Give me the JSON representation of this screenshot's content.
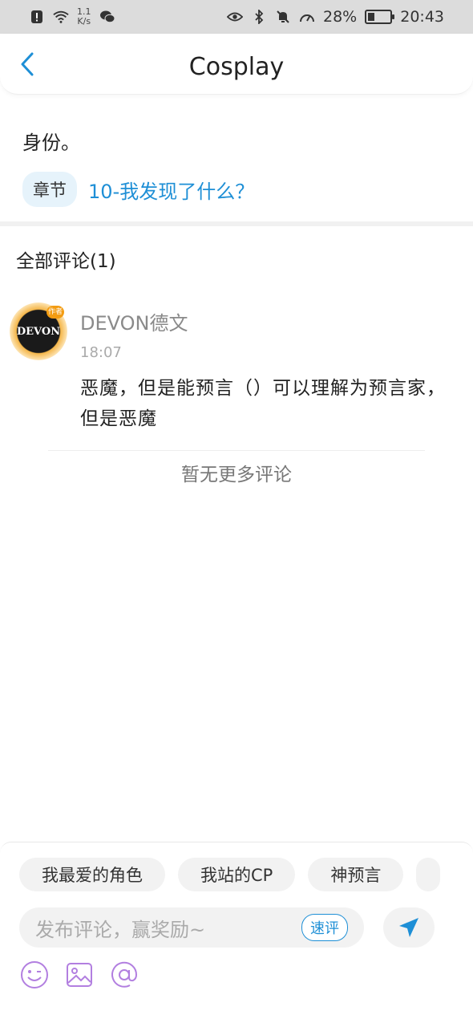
{
  "status_bar": {
    "net_speed_value": "1.1",
    "net_speed_unit": "K/s",
    "battery_percent": "28%",
    "battery_level": 0.28,
    "time": "20:43"
  },
  "header": {
    "title": "Cosplay"
  },
  "intro": {
    "text": "身份。",
    "chapter_tag": "章节",
    "chapter_link": "10-我发现了什么？"
  },
  "comments": {
    "header": "全部评论(1)",
    "items": [
      {
        "avatar_text": "DEVON",
        "avatar_badge": "作者",
        "user": "DEVON德文",
        "time": "18:07",
        "body": "恶魔，但是能预言（）可以理解为预言家，但是恶魔"
      }
    ],
    "no_more": "暂无更多评论"
  },
  "bottom": {
    "quick_chips": [
      "我最爱的角色",
      "我站的CP",
      "神预言"
    ],
    "input_placeholder": "发布评论，赢奖励~",
    "quick_review": "速评"
  },
  "colors": {
    "accent": "#1e8fd6",
    "tool_icon": "#b27fe0",
    "status_bar_bg": "#dcdcdc"
  }
}
